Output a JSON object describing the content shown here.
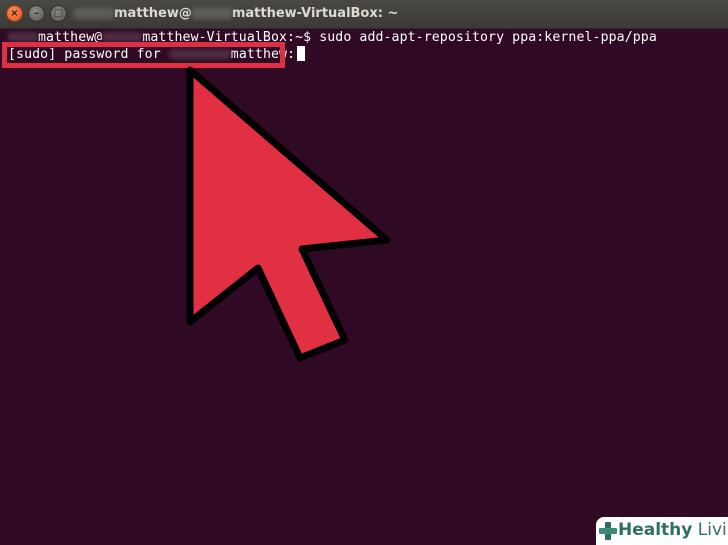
{
  "window": {
    "title_prefix": "matthew@",
    "title_suffix": "matthew-VirtualBox: ~",
    "close_glyph": "×",
    "min_glyph": "–",
    "max_glyph": "□"
  },
  "terminal": {
    "prompt_user": "matthew@",
    "prompt_host": "matthew-VirtualBox:~$ ",
    "command": "sudo add-apt-repository ppa:kernel-ppa/ppa",
    "sudo_prefix": "[sudo] password for ",
    "sudo_user": "matthew:"
  },
  "colors": {
    "terminal_bg": "#300a24",
    "highlight": "#de2f43",
    "arrow_fill": "#e03041"
  },
  "icons": {
    "arrow": "pointer-arrow-icon",
    "logo": "healthy-living-plus-icon"
  },
  "watermark": {
    "word1": "Healthy",
    "word2": " Living"
  }
}
